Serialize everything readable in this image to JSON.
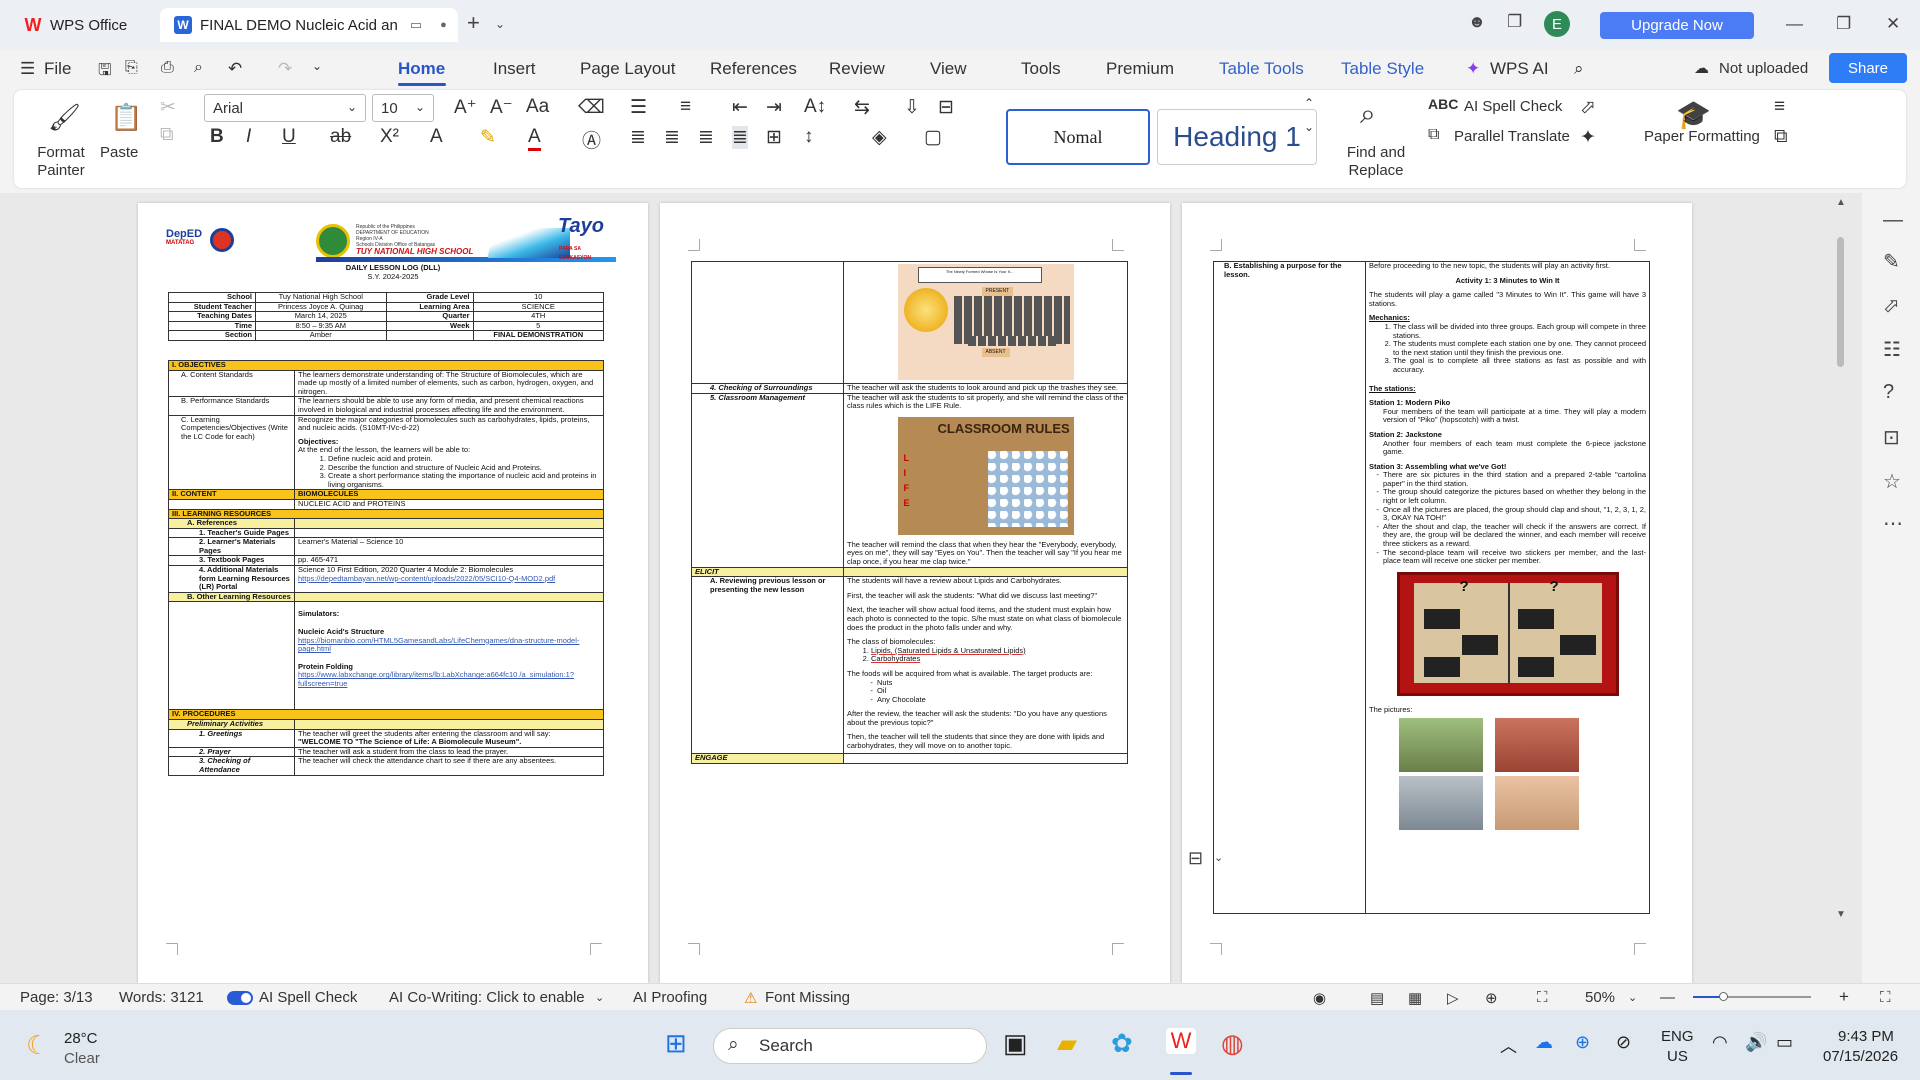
{
  "tabs": {
    "app_tab": "WPS Office",
    "doc_tab": "FINAL DEMO Nucleic Acid an",
    "upgrade": "Upgrade Now",
    "user_initial": "E"
  },
  "menu": {
    "file": "File",
    "items": [
      "Home",
      "Insert",
      "Page Layout",
      "References",
      "Review",
      "View",
      "Tools",
      "Premium"
    ],
    "context": [
      "Table Tools",
      "Table Style"
    ],
    "wps_ai": "WPS AI",
    "not_uploaded": "Not uploaded",
    "share": "Share"
  },
  "ribbon": {
    "format_painter": "Format Painter",
    "paste": "Paste",
    "font_name": "Arial",
    "font_size": "10",
    "style_normal": "Nomal",
    "style_heading1": "Heading 1",
    "find_replace": "Find and Replace",
    "ai_spell_check": "AI Spell Check",
    "parallel_translate": "Parallel Translate",
    "paper_formatting": "Paper Formatting"
  },
  "page1": {
    "header": {
      "republic": "Republic of the Philippines",
      "dept": "DEPARTMENT OF EDUCATION",
      "region": "Region IV-A",
      "division": "Schools Division Office of Batangas",
      "school_name": "TUY NATIONAL HIGH SCHOOL",
      "tayo": "Tayo",
      "tayo_sub": "PARA SA EDUKASYON",
      "deped": "DepED",
      "matatag": "MATATAG",
      "log_title": "DAILY LESSON LOG (DLL)",
      "school_year": "S.Y. 2024-2025"
    },
    "info": [
      [
        "School",
        "Tuy National High School",
        "Grade Level",
        "10"
      ],
      [
        "Student Teacher",
        "Princess Joyce A. Quinag",
        "Learning Area",
        "SCIENCE"
      ],
      [
        "Teaching Dates",
        "March 14, 2025",
        "Quarter",
        "4TH"
      ],
      [
        "Time",
        "8:50 – 9:35 AM",
        "Week",
        "5"
      ],
      [
        "Section",
        "Amber",
        "",
        "FINAL DEMONSTRATION"
      ]
    ],
    "objectives_label": "I. OBJECTIVES",
    "content_standards_label": "A.  Content Standards",
    "content_standards_text": "The learners demonstrate understanding of: The Structure of Biomolecules, which are made up mostly of a limited number of elements, such as carbon, hydrogen, oxygen, and nitrogen.",
    "performance_label": "B.  Performance Standards",
    "performance_text": "The learners should be able to use any form of media, and present chemical reactions involved in biological and industrial processes affecting life and the environment.",
    "competencies_label": "C.  Learning Competencies/Objectives (Write the LC Code for each)",
    "competencies_text": "Recognize the major categories of biomolecules such as carbohydrates, lipids, proteins, and nucleic acids. (S10MT-IVc-d-22)",
    "objectives_heading": "Objectives:",
    "objectives_intro": "At the end of the lesson, the learners will be able to:",
    "objectives_list": [
      "Define nucleic acid and protein.",
      "Describe the function and structure of Nucleic Acid and Proteins.",
      "Create a short performance stating the importance of nucleic acid and proteins in living organisms."
    ],
    "content_label": "II.  CONTENT",
    "content_value": "BIOMOLECULES",
    "content_sub": "NUCLEIC ACID and PROTEINS",
    "resources_label": "III.  LEARNING RESOURCES",
    "references_label": "A.  References",
    "ref_rows": [
      [
        "1.  Teacher's Guide Pages",
        ""
      ],
      [
        "2.  Learner's Materials Pages",
        "Learner's Material – Science 10"
      ],
      [
        "3.  Textbook Pages",
        "pp. 465-471"
      ],
      [
        "4.  Additional Materials form Learning Resources (LR) Portal",
        "Science 10 First Edition, 2020 Quarter 4 Module 2: Biomolecules"
      ]
    ],
    "lr_link": "https://depedtambayan.net/wp-content/uploads/2022/05/SCI10-Q4-MOD2.pdf",
    "other_resources_label": "B.  Other Learning Resources",
    "simulators_label": "Simulators:",
    "sim1_title": "Nucleic Acid's Structure",
    "sim1_link": "https://biomanbio.com/HTML5GamesandLabs/LifeChemgames/dna-structure-model-page.html",
    "sim2_title": "Protein Folding",
    "sim2_link": "https://www.labxchange.org/library/items/lb:LabXchange:a664fc10 /a_simulation:1?fullscreen=true",
    "procedures_label": "IV.  PROCEDURES",
    "preliminary_label": "Preliminary Activities",
    "proc_rows": [
      [
        "1.  Greetings",
        "The teacher will greet the students after entering the classroom and will say:"
      ],
      [
        "2.  Prayer",
        "The teacher will ask a student from the class to lead the prayer."
      ],
      [
        "3.  Checking of Attendance",
        "The teacher will check the attendance chart to see if there are any absentees."
      ]
    ],
    "welcome_text": "\"WELCOME TO \"The Science of Life: A Biomolecule Museum\"."
  },
  "page2": {
    "attendance_title": "The Newly Formed Whose Is Your It...",
    "present_label": "PRESENT",
    "absent_label": "ABSENT",
    "surroundings_label": "4.  Checking of Surroundings",
    "surroundings_text": "The teacher will ask the students to look around and pick up the trashes they see.",
    "management_label": "5.  Classroom Management",
    "management_text": "The teacher will ask the students to sit properly, and she will remind the class of the class rules which is the LIFE Rule.",
    "rules_title": "CLASSROOM RULES",
    "rules_letters": [
      "L",
      "I",
      "F",
      "E"
    ],
    "rules_text": "The teacher will remind the class that when they hear the \"Everybody, everybody, eyes on me\", they will say \"Eyes on You\". Then the teacher will say \"If you hear me clap once, if you hear me clap twice.\"",
    "elicit_label": "ELICIT",
    "review_label": "A.  Reviewing previous lesson or presenting the new lesson",
    "review_p1": "The students will have a review about Lipids and Carbohydrates.",
    "review_p2": "First, the teacher will ask the students: \"What did we discuss last meeting?\"",
    "review_p3": "Next, the teacher will show actual food items, and the student must explain how each photo is connected to the topic. S/he must state on what class of biomolecule does the product in the photo falls under and why.",
    "review_p4": "The class of biomolecules:",
    "review_list": [
      "Lipids, (Saturated Lipids & Unsaturated Lipids)",
      "Carbohydrates"
    ],
    "review_p5": "The foods will be acquired from what is available. The target products are:",
    "food_list": [
      "Nuts",
      "Oil",
      "Any Chocolate"
    ],
    "review_p6": "After the review, the teacher will ask the students: \"Do you have any questions about the previous topic?\"",
    "review_p7": "Then, the teacher will tell the students that since they are done with lipids and carbohydrates, they will move on to another topic.",
    "engage_label": "ENGAGE"
  },
  "page3": {
    "purpose_label": "B.  Establishing a purpose for the lesson.",
    "intro": "Before proceeding to the new topic, the students will play an activity first.",
    "activity_title": "Activity 1: 3 Minutes to Win It",
    "game_desc": "The students will play a game called \"3 Minutes to Win It\". This game will have 3 stations.",
    "mechanics_label": "Mechanics:",
    "mechanics": [
      "The class will be divided into three groups. Each group will compete in three stations.",
      "The students must complete each station one by one. They cannot proceed to the next station until they finish the previous one.",
      "The goal is to complete all three stations as fast as possible and with accuracy."
    ],
    "stations_label": "The stations:",
    "station1_title": "Station 1: Modern Piko",
    "station1_text": "Four members of the team will participate at a time. They will play a modern version of \"Piko\" (hopscotch) with a twist.",
    "station2_title": "Station 2: Jackstone",
    "station2_text": "Another four members of each team must complete the 6-piece jackstone game.",
    "station3_title": "Station 3: Assembling what we've Got!",
    "station3_items": [
      "There are six pictures in the third station and a prepared 2-table \"cartolina paper\" in the third station.",
      "The group should categorize the pictures based on whether they belong in the right or left column.",
      "Once all the pictures are placed, the group should clap and shout, \"1, 2, 3, 1, 2, 3, OKAY NA TOH!\"",
      "After the shout and clap, the teacher will check if the answers are correct. If they are, the group will be declared the winner, and each member will receive three stickers as a reward.",
      "The second-place team will receive two stickers per member, and the last-place team will receive one sticker per member."
    ],
    "question_mark": "?",
    "pictures_label": "The pictures:"
  },
  "status": {
    "page": "Page: 3/13",
    "words": "Words: 3121",
    "ai_spell": "AI Spell Check",
    "co_writing": "AI Co-Writing: Click to enable",
    "ai_proofing": "AI Proofing",
    "font_missing": "Font Missing",
    "zoom": "50%"
  },
  "taskbar": {
    "temp": "28°C",
    "weather": "Clear",
    "search": "Search",
    "lang1": "ENG",
    "lang2": "US",
    "time": "9:43 PM",
    "date": "07/15/2026"
  },
  "colors": {
    "accent": "#2a55c8",
    "upgrade": "#4b7bf5",
    "share": "#2e7cf6",
    "yellow_header": "#f8c31b"
  }
}
